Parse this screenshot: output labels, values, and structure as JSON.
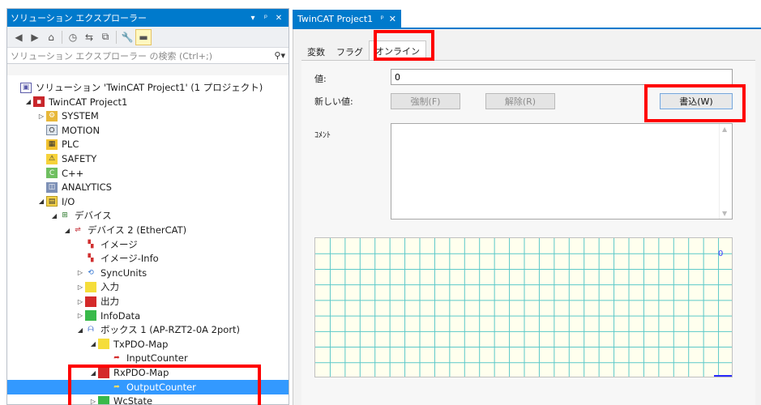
{
  "solution_explorer": {
    "title": "ソリューション エクスプローラー",
    "controls": [
      "▾",
      "ᵖ",
      "✕"
    ],
    "search_placeholder": "ソリューション エクスプローラー の検索 (Ctrl+;)",
    "tree": [
      {
        "label": "ソリューション 'TwinCAT Project1' (1 プロジェクト)",
        "icon": "solution-icon",
        "level": 0,
        "exp": ""
      },
      {
        "label": "TwinCAT Project1",
        "icon": "project-icon",
        "level": 1,
        "exp": "◢"
      },
      {
        "label": "SYSTEM",
        "icon": "system-icon",
        "level": 2,
        "exp": "▷"
      },
      {
        "label": "MOTION",
        "icon": "motion-icon",
        "level": 2,
        "exp": ""
      },
      {
        "label": "PLC",
        "icon": "plc-icon",
        "level": 2,
        "exp": ""
      },
      {
        "label": "SAFETY",
        "icon": "safety-icon",
        "level": 2,
        "exp": ""
      },
      {
        "label": "C++",
        "icon": "cpp-icon",
        "level": 2,
        "exp": ""
      },
      {
        "label": "ANALYTICS",
        "icon": "analytics-icon",
        "level": 2,
        "exp": ""
      },
      {
        "label": "I/O",
        "icon": "io-icon",
        "level": 2,
        "exp": "◢"
      },
      {
        "label": "デバイス",
        "icon": "devices-icon",
        "level": 3,
        "exp": "◢"
      },
      {
        "label": "デバイス 2 (EtherCAT)",
        "icon": "ethercat-device-icon",
        "level": 4,
        "exp": "◢"
      },
      {
        "label": "イメージ",
        "icon": "image-icon",
        "level": 5,
        "exp": ""
      },
      {
        "label": "イメージ-Info",
        "icon": "image-info-icon",
        "level": 5,
        "exp": ""
      },
      {
        "label": "SyncUnits",
        "icon": "syncunits-icon",
        "level": 5,
        "exp": "▷"
      },
      {
        "label": "入力",
        "icon": "input-folder-icon",
        "level": 5,
        "exp": "▷"
      },
      {
        "label": "出力",
        "icon": "output-folder-icon",
        "level": 5,
        "exp": "▷"
      },
      {
        "label": "InfoData",
        "icon": "infodata-icon",
        "level": 5,
        "exp": "▷"
      },
      {
        "label": "ボックス 1 (AP-RZT2-0A 2port)",
        "icon": "box-icon",
        "level": 5,
        "exp": "◢"
      },
      {
        "label": "TxPDO-Map",
        "icon": "txpdo-icon",
        "level": 6,
        "exp": "◢"
      },
      {
        "label": "InputCounter",
        "icon": "input-var-icon",
        "level": 7,
        "exp": ""
      },
      {
        "label": "RxPDO-Map",
        "icon": "rxpdo-icon",
        "level": 6,
        "exp": "◢"
      },
      {
        "label": "OutputCounter",
        "icon": "output-var-icon",
        "level": 7,
        "exp": "",
        "selected": true
      },
      {
        "label": "WcState",
        "icon": "wcstate-icon",
        "level": 6,
        "exp": "▷"
      }
    ]
  },
  "document": {
    "tab_title": "TwinCAT Project1",
    "tab_pin": "ᵖ",
    "tab_close": "✕",
    "subtabs": [
      "変数",
      "フラグ",
      "オンライン"
    ],
    "active_subtab": 2,
    "online": {
      "value_label": "値:",
      "value": "0",
      "new_value_label": "新しい値:",
      "force_button": "強制(F)",
      "release_button": "解除(R)",
      "write_button": "書込(W)",
      "comment_label": "ｺﾒﾝﾄ",
      "chart_scale_label": "0"
    }
  },
  "colors": {
    "accent": "#007acc",
    "selection": "#3399ff",
    "highlight": "#ff0000",
    "chart_grid": "#5cc9c9",
    "chart_bg": "#ffffee"
  }
}
